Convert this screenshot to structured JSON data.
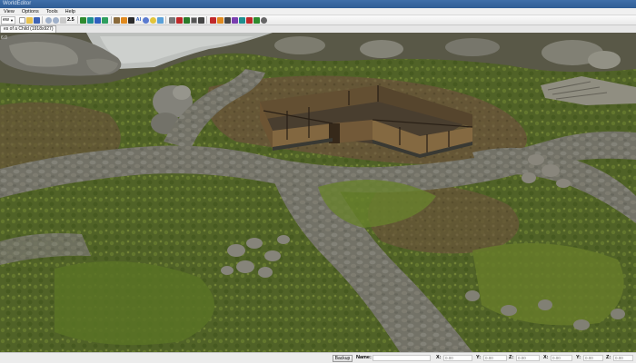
{
  "window": {
    "title": "WorldEditor"
  },
  "menu": {
    "items": [
      "View",
      "Options",
      "Tools",
      "Help"
    ]
  },
  "toolbar": {
    "view_dropdown": "ew",
    "zoom_label": "2.5",
    "ai_label": "AI",
    "colors": {
      "green": "#2e8b2e",
      "blue": "#2f5fbf",
      "red": "#c0282a",
      "orange": "#e08a1e",
      "purple": "#7a3fb0",
      "teal": "#1f8f8f"
    }
  },
  "document_tab": {
    "label": "es of a Child (1918x927)"
  },
  "viewport": {
    "fps": "6.0"
  },
  "statusbar": {
    "button_label": "Backup",
    "name_label": "Name:",
    "name_value": "",
    "x_label": "X:",
    "x_value": "0.00",
    "y_label": "Y:",
    "y_value": "0.00",
    "z_label": "Z:",
    "z_value": "0.00",
    "x2_label": "X:",
    "x2_value": "0.00",
    "y2_label": "Y:",
    "y2_value": "0.00",
    "z2_label": "Z:",
    "z2_value": "0.00"
  }
}
